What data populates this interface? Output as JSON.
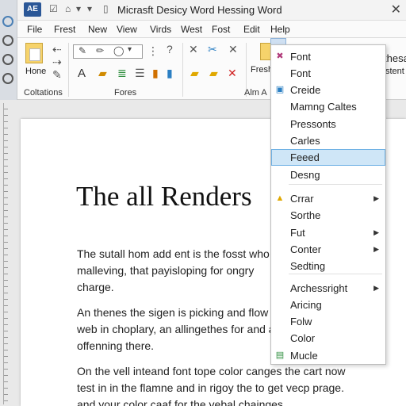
{
  "app": {
    "logo": "AE",
    "title": "Micrasft Desicy Word Hessing Word",
    "quick_access": [
      "☑",
      "⌂",
      "▾",
      "▾"
    ]
  },
  "menu": {
    "items": [
      "File",
      "Frest",
      "New",
      "View",
      "Virds",
      "West",
      "Fost",
      "Edit",
      "Help"
    ]
  },
  "ribbon": {
    "home_label": "Hone",
    "collations_label": "Coltations",
    "fonts_label": "Fores",
    "alm_label": "Alm A",
    "fresh_label": "Fresh",
    "right_fragment_1": "thesa",
    "right_fragment_2": "stent"
  },
  "dropdown": {
    "items": [
      {
        "label": "Font",
        "icon": "✖",
        "icon_color": "#b03a7a",
        "arrow": false,
        "highlight": false
      },
      {
        "label": "Font",
        "icon": "",
        "icon_color": "",
        "arrow": false,
        "highlight": false
      },
      {
        "label": "Creide",
        "icon": "▣",
        "icon_color": "#2b7fc3",
        "arrow": false,
        "highlight": false
      },
      {
        "label": "Mamng Caltes",
        "icon": "",
        "icon_color": "",
        "arrow": false,
        "highlight": false
      },
      {
        "label": "Pressonts",
        "icon": "",
        "icon_color": "",
        "arrow": false,
        "highlight": false
      },
      {
        "label": "Carles",
        "icon": "",
        "icon_color": "",
        "arrow": false,
        "highlight": false
      },
      {
        "label": "Feeed",
        "icon": "",
        "icon_color": "",
        "arrow": false,
        "highlight": true
      },
      {
        "label": "Desng",
        "icon": "",
        "icon_color": "",
        "arrow": false,
        "highlight": false
      },
      {
        "label": "Crrar",
        "icon": "▲",
        "icon_color": "#e0a800",
        "arrow": true,
        "highlight": false
      },
      {
        "label": "Sorthe",
        "icon": "",
        "icon_color": "",
        "arrow": false,
        "highlight": false
      },
      {
        "label": "Fut",
        "icon": "",
        "icon_color": "",
        "arrow": true,
        "highlight": false
      },
      {
        "label": "Conter",
        "icon": "",
        "icon_color": "",
        "arrow": true,
        "highlight": false
      },
      {
        "label": "Sedting",
        "icon": "",
        "icon_color": "",
        "arrow": false,
        "highlight": false
      },
      {
        "label": "Archessright",
        "icon": "",
        "icon_color": "",
        "arrow": true,
        "highlight": false
      },
      {
        "label": "Aricing",
        "icon": "",
        "icon_color": "",
        "arrow": false,
        "highlight": false
      },
      {
        "label": "Folw",
        "icon": "",
        "icon_color": "",
        "arrow": false,
        "highlight": false
      },
      {
        "label": "Color",
        "icon": "",
        "icon_color": "",
        "arrow": false,
        "highlight": false
      },
      {
        "label": "Mucle",
        "icon": "▤",
        "icon_color": "#2f8f3f",
        "arrow": false,
        "highlight": false
      }
    ]
  },
  "document": {
    "heading": "The all Renders",
    "paragraphs": [
      [
        "The sutall hom add ent is the fosst who",
        "malleving, that payisloping for ongry",
        "charge."
      ],
      [
        "An thenes the sigen is picking and flow",
        "web in choplary, an allingethes for and a",
        "offenning there."
      ],
      [
        "On the vell inteand font tope color canges the cart now",
        "test in in the flamne and in rigoy the to get vecp prage.",
        "and your color caaf for the vebal chainges."
      ]
    ]
  },
  "colors": {
    "accent": "#2b5797",
    "highlight_bg": "#cfe6f7",
    "highlight_border": "#6fb1e4"
  }
}
